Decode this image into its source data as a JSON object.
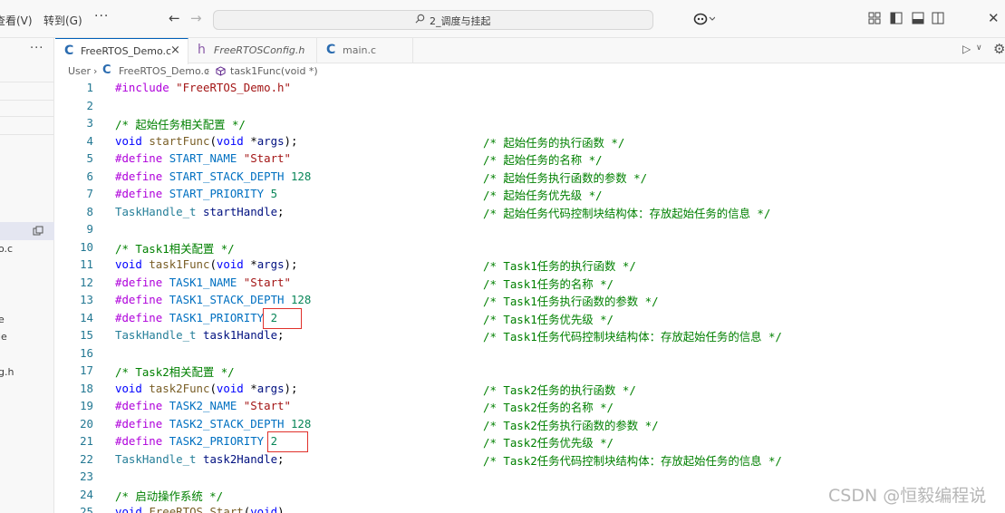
{
  "titlebar": {
    "menu_view": "查看(V)",
    "menu_goto": "转到(G)",
    "menu_more": "···",
    "search_text": "2_调度与挂起"
  },
  "sidebar": {
    "more": "···",
    "items": [
      {
        "label": "o.c"
      },
      {
        "label": "e"
      },
      {
        "label": "le"
      },
      {
        "label": "g.h"
      }
    ]
  },
  "tabs": [
    {
      "label": "FreeRTOS_Demo.c",
      "icon": "c-file-icon",
      "active": true,
      "close": "×"
    },
    {
      "label": "FreeRTOSConfig.h",
      "icon": "h-file-icon",
      "active": false
    },
    {
      "label": "main.c",
      "icon": "c-file-icon",
      "active": false
    }
  ],
  "breadcrumb": {
    "root": "User",
    "file": "FreeRTOS_Demo.c",
    "symbol": "task1Func(void *)"
  },
  "code_lines": [
    {
      "n": "1",
      "code": [
        [
          "pp",
          "#include "
        ],
        [
          "str",
          "\"FreeRTOS_Demo.h\""
        ]
      ],
      "comment": ""
    },
    {
      "n": "2",
      "code": [],
      "comment": ""
    },
    {
      "n": "3",
      "code": [
        [
          "cmt",
          "/* 起始任务相关配置 */"
        ]
      ],
      "comment": ""
    },
    {
      "n": "4",
      "code": [
        [
          "kw",
          "void "
        ],
        [
          "fn",
          "startFunc"
        ],
        [
          "plain",
          "("
        ],
        [
          "kw",
          "void "
        ],
        [
          "plain",
          "*"
        ],
        [
          "var",
          "args"
        ],
        [
          "plain",
          ");"
        ]
      ],
      "comment": "/* 起始任务的执行函数 */"
    },
    {
      "n": "5",
      "code": [
        [
          "pp",
          "#define "
        ],
        [
          "mac",
          "START_NAME "
        ],
        [
          "str",
          "\"Start\""
        ]
      ],
      "comment": "/* 起始任务的名称 */"
    },
    {
      "n": "6",
      "code": [
        [
          "pp",
          "#define "
        ],
        [
          "mac",
          "START_STACK_DEPTH "
        ],
        [
          "num",
          "128"
        ]
      ],
      "comment": "/* 起始任务执行函数的参数 */"
    },
    {
      "n": "7",
      "code": [
        [
          "pp",
          "#define "
        ],
        [
          "mac",
          "START_PRIORITY "
        ],
        [
          "num",
          "5"
        ]
      ],
      "comment": "/* 起始任务优先级 */"
    },
    {
      "n": "8",
      "code": [
        [
          "type",
          "TaskHandle_t "
        ],
        [
          "var",
          "startHandle"
        ],
        [
          "plain",
          ";"
        ]
      ],
      "comment": "/* 起始任务代码控制块结构体：存放起始任务的信息 */"
    },
    {
      "n": "9",
      "code": [],
      "comment": ""
    },
    {
      "n": "10",
      "code": [
        [
          "cmt",
          "/* Task1相关配置 */"
        ]
      ],
      "comment": ""
    },
    {
      "n": "11",
      "code": [
        [
          "kw",
          "void "
        ],
        [
          "fn",
          "task1Func"
        ],
        [
          "plain",
          "("
        ],
        [
          "kw",
          "void "
        ],
        [
          "plain",
          "*"
        ],
        [
          "var",
          "args"
        ],
        [
          "plain",
          ");"
        ]
      ],
      "comment": "/* Task1任务的执行函数 */"
    },
    {
      "n": "12",
      "code": [
        [
          "pp",
          "#define "
        ],
        [
          "mac",
          "TASK1_NAME "
        ],
        [
          "str",
          "\"Start\""
        ]
      ],
      "comment": "/* Task1任务的名称 */"
    },
    {
      "n": "13",
      "code": [
        [
          "pp",
          "#define "
        ],
        [
          "mac",
          "TASK1_STACK_DEPTH "
        ],
        [
          "num",
          "128"
        ]
      ],
      "comment": "/* Task1任务执行函数的参数 */"
    },
    {
      "n": "14",
      "code": [
        [
          "pp",
          "#define "
        ],
        [
          "mac",
          "TASK1_PRIORITY "
        ],
        [
          "num",
          "2"
        ]
      ],
      "comment": "/* Task1任务优先级 */"
    },
    {
      "n": "15",
      "code": [
        [
          "type",
          "TaskHandle_t "
        ],
        [
          "var",
          "task1Handle"
        ],
        [
          "plain",
          ";"
        ]
      ],
      "comment": "/* Task1任务代码控制块结构体：存放起始任务的信息 */"
    },
    {
      "n": "16",
      "code": [],
      "comment": ""
    },
    {
      "n": "17",
      "code": [
        [
          "cmt",
          "/* Task2相关配置 */"
        ]
      ],
      "comment": ""
    },
    {
      "n": "18",
      "code": [
        [
          "kw",
          "void "
        ],
        [
          "fn",
          "task2Func"
        ],
        [
          "plain",
          "("
        ],
        [
          "kw",
          "void "
        ],
        [
          "plain",
          "*"
        ],
        [
          "var",
          "args"
        ],
        [
          "plain",
          ");"
        ]
      ],
      "comment": "/* Task2任务的执行函数 */"
    },
    {
      "n": "19",
      "code": [
        [
          "pp",
          "#define "
        ],
        [
          "mac",
          "TASK2_NAME "
        ],
        [
          "str",
          "\"Start\""
        ]
      ],
      "comment": "/* Task2任务的名称 */"
    },
    {
      "n": "20",
      "code": [
        [
          "pp",
          "#define "
        ],
        [
          "mac",
          "TASK2_STACK_DEPTH "
        ],
        [
          "num",
          "128"
        ]
      ],
      "comment": "/* Task2任务执行函数的参数 */"
    },
    {
      "n": "21",
      "code": [
        [
          "pp",
          "#define "
        ],
        [
          "mac",
          "TASK2_PRIORITY "
        ],
        [
          "num",
          "2"
        ]
      ],
      "comment": "/* Task2任务优先级 */"
    },
    {
      "n": "22",
      "code": [
        [
          "type",
          "TaskHandle_t "
        ],
        [
          "var",
          "task2Handle"
        ],
        [
          "plain",
          ";"
        ]
      ],
      "comment": "/* Task2任务代码控制块结构体：存放起始任务的信息 */"
    },
    {
      "n": "23",
      "code": [],
      "comment": ""
    },
    {
      "n": "24",
      "code": [
        [
          "cmt",
          "/* 启动操作系统 */"
        ]
      ],
      "comment": ""
    },
    {
      "n": "25",
      "code": [
        [
          "kw",
          "void "
        ],
        [
          "fn",
          "FreeRTOS_Start"
        ],
        [
          "plain",
          "("
        ],
        [
          "kw",
          "void"
        ],
        [
          "plain",
          ")"
        ]
      ],
      "comment": ""
    }
  ],
  "colors": {
    "preprocessor": "#af00db",
    "string": "#a31515",
    "comment": "#008000",
    "keyword": "#0000ff",
    "highlight_box": "#e0312b"
  },
  "watermark": "CSDN @恒毅编程说"
}
